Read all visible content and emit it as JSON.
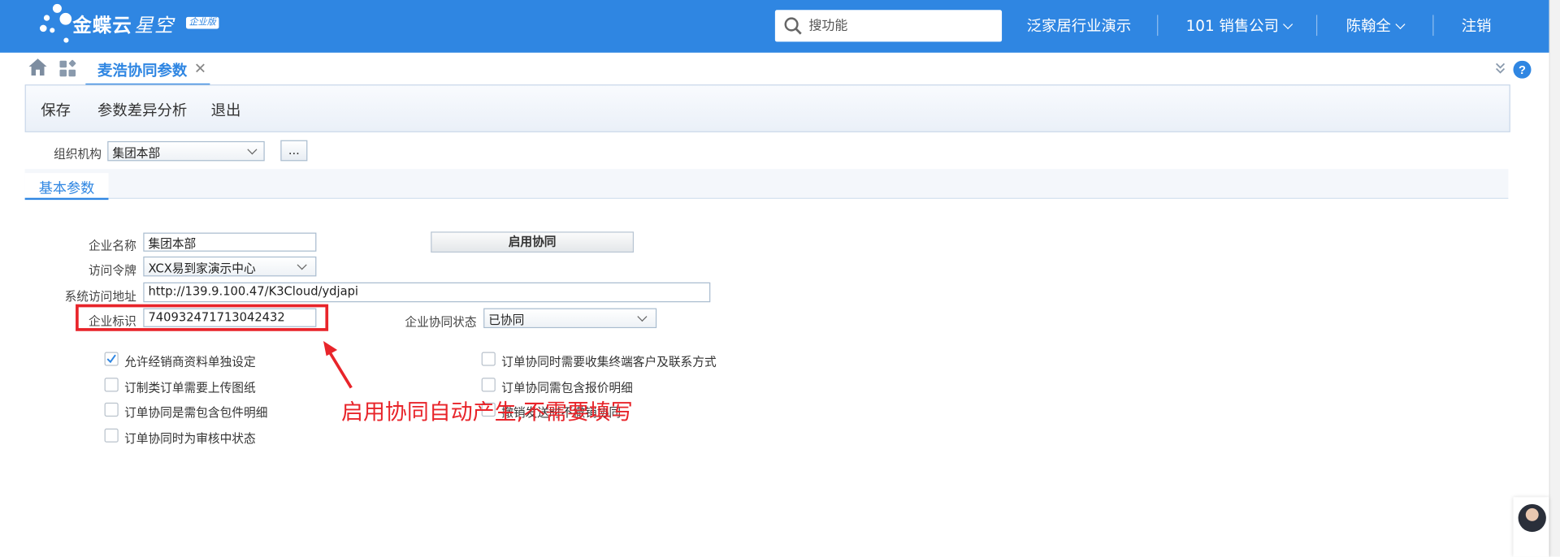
{
  "app": {
    "brand": "金蝶云",
    "brand_sub": "星空",
    "edition": "企业版"
  },
  "topbar": {
    "search_placeholder": "搜功能",
    "datacenter": "泛家居行业演示",
    "org": "101 销售公司",
    "user": "陈翰全",
    "logout": "注销"
  },
  "tabs": [
    {
      "label": "麦浩协同参数",
      "close": "✕"
    }
  ],
  "toolbar": {
    "save": "保存",
    "diff": "参数差异分析",
    "exit": "退出"
  },
  "org_selector": {
    "label": "组织机构",
    "value": "集团本部",
    "more": "..."
  },
  "section_tab": "基本参数",
  "form": {
    "company_name_label": "企业名称",
    "company_name": "集团本部",
    "enable_button": "启用协同",
    "token_label": "访问令牌",
    "token": "XCX易到家演示中心",
    "url_label": "系统访问地址",
    "url": "http://139.9.100.47/K3Cloud/ydjapi",
    "company_id_label": "企业标识",
    "company_id": "740932471713042432",
    "status_label": "企业协同状态",
    "status": "已协同"
  },
  "options_left": [
    {
      "label": "允许经销商资料单独设定",
      "checked": true
    },
    {
      "label": "订制类订单需要上传图纸",
      "checked": false
    },
    {
      "label": "订单协同是需包含包件明细",
      "checked": false
    },
    {
      "label": "订单协同时为审核中状态",
      "checked": false
    }
  ],
  "options_right": [
    {
      "label": "订单协同时需要收集终端客户及联系方式",
      "checked": false
    },
    {
      "label": "订单协同需包含报价明细",
      "checked": false
    },
    {
      "label": "撤销发送时不撤销协同",
      "checked": false
    }
  ],
  "annotation": "启用协同自动产生,不需要填写",
  "colors": {
    "topbar": "#2f86e2",
    "accent": "#2f86e2",
    "annotation": "#e8242a"
  }
}
